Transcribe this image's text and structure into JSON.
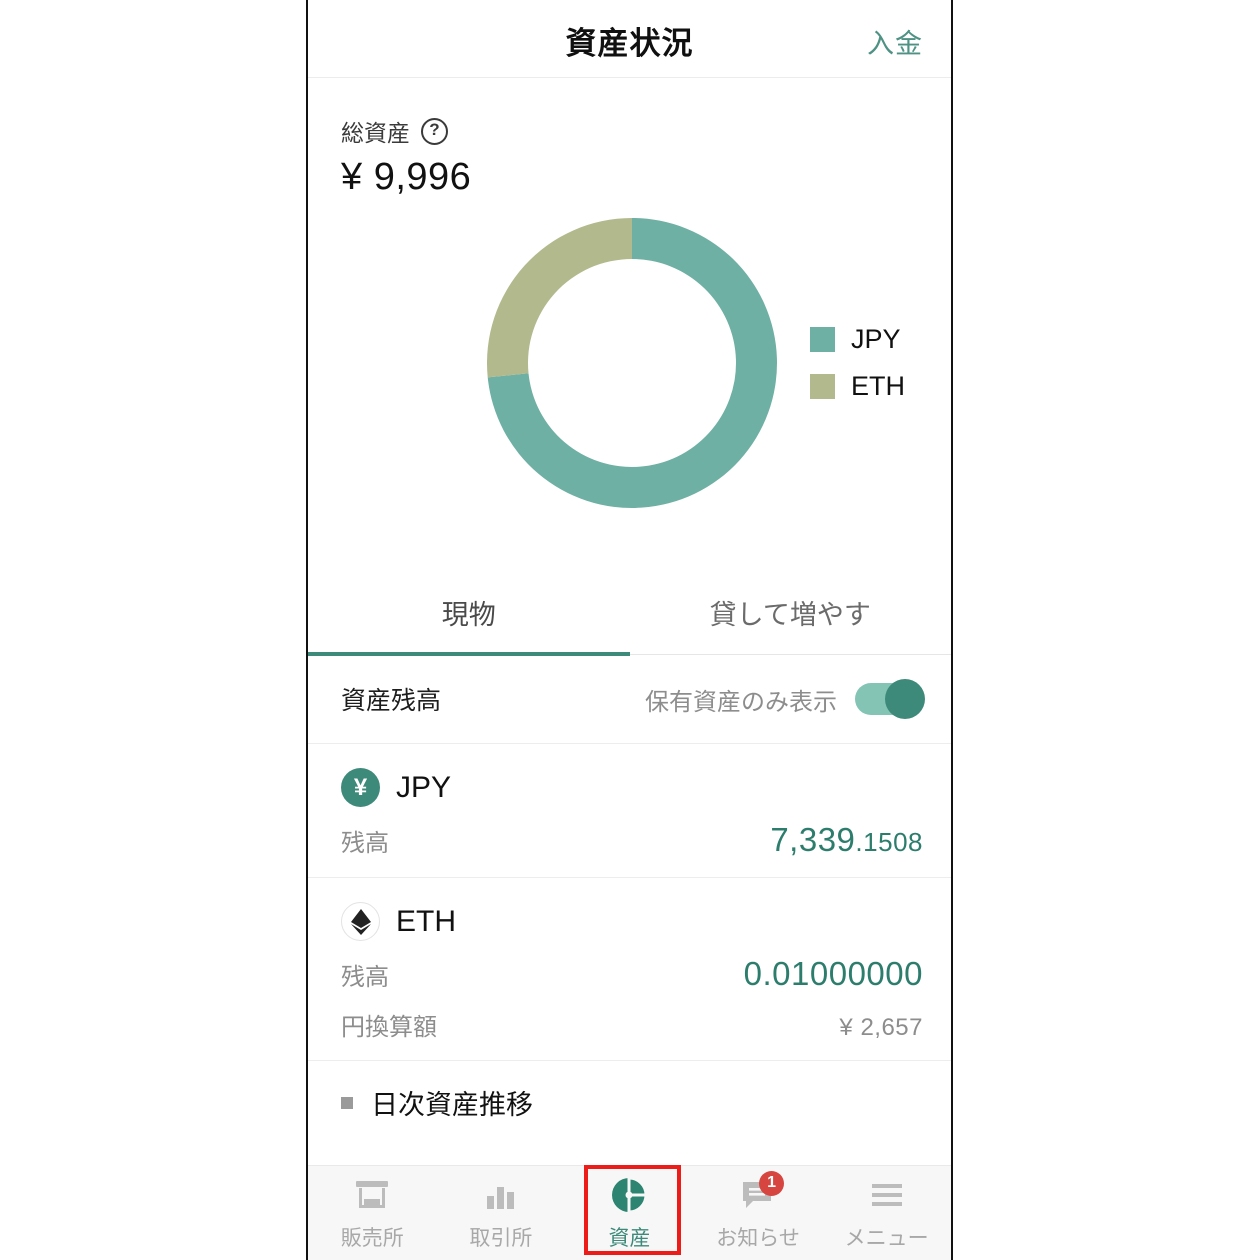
{
  "header": {
    "title": "資産状況",
    "action_label": "入金"
  },
  "summary": {
    "label": "総資産",
    "help_icon": "question-circle-icon",
    "value": "¥ 9,996"
  },
  "chart_data": {
    "type": "pie",
    "title": "総資産",
    "categories": [
      "JPY",
      "ETH"
    ],
    "values": [
      7339,
      2657
    ],
    "percentages": [
      73.4,
      26.6
    ],
    "colors": [
      "#6eb0a3",
      "#b2b98c"
    ],
    "legend_position": "right",
    "donut": true,
    "start_angle": 0,
    "units": "JPY",
    "legend": [
      {
        "label": "JPY",
        "color": "#6eb0a3"
      },
      {
        "label": "ETH",
        "color": "#b2b98c"
      }
    ]
  },
  "tabs": [
    {
      "label": "現物",
      "active": true
    },
    {
      "label": "貸して増やす",
      "active": false
    }
  ],
  "balance_header": {
    "title": "資産残高",
    "toggle_label": "保有資産のみ表示",
    "toggle_on": true
  },
  "assets": [
    {
      "icon": "jpy-coin-icon",
      "icon_glyph": "¥",
      "name": "JPY",
      "balance_key": "残高",
      "balance_int": "7,339",
      "balance_frac": ".1508"
    },
    {
      "icon": "eth-coin-icon",
      "name": "ETH",
      "balance_key": "残高",
      "balance_value": "0.01000000",
      "converted_key": "円換算額",
      "converted_value": "¥ 2,657"
    }
  ],
  "next_section": {
    "label": "日次資産推移"
  },
  "bottom_nav": [
    {
      "label": "販売所",
      "icon": "store-icon",
      "active": false
    },
    {
      "label": "取引所",
      "icon": "bar-chart-icon",
      "active": false
    },
    {
      "label": "資産",
      "icon": "pie-chart-icon",
      "active": true
    },
    {
      "label": "お知らせ",
      "icon": "message-icon",
      "active": false,
      "badge": "1"
    },
    {
      "label": "メニュー",
      "icon": "hamburger-icon",
      "active": false
    }
  ],
  "colors": {
    "accent": "#3d8a7a",
    "jpy": "#6eb0a3",
    "eth": "#b2b98c",
    "badge": "#d6453f",
    "highlight": "#ee1c18"
  }
}
